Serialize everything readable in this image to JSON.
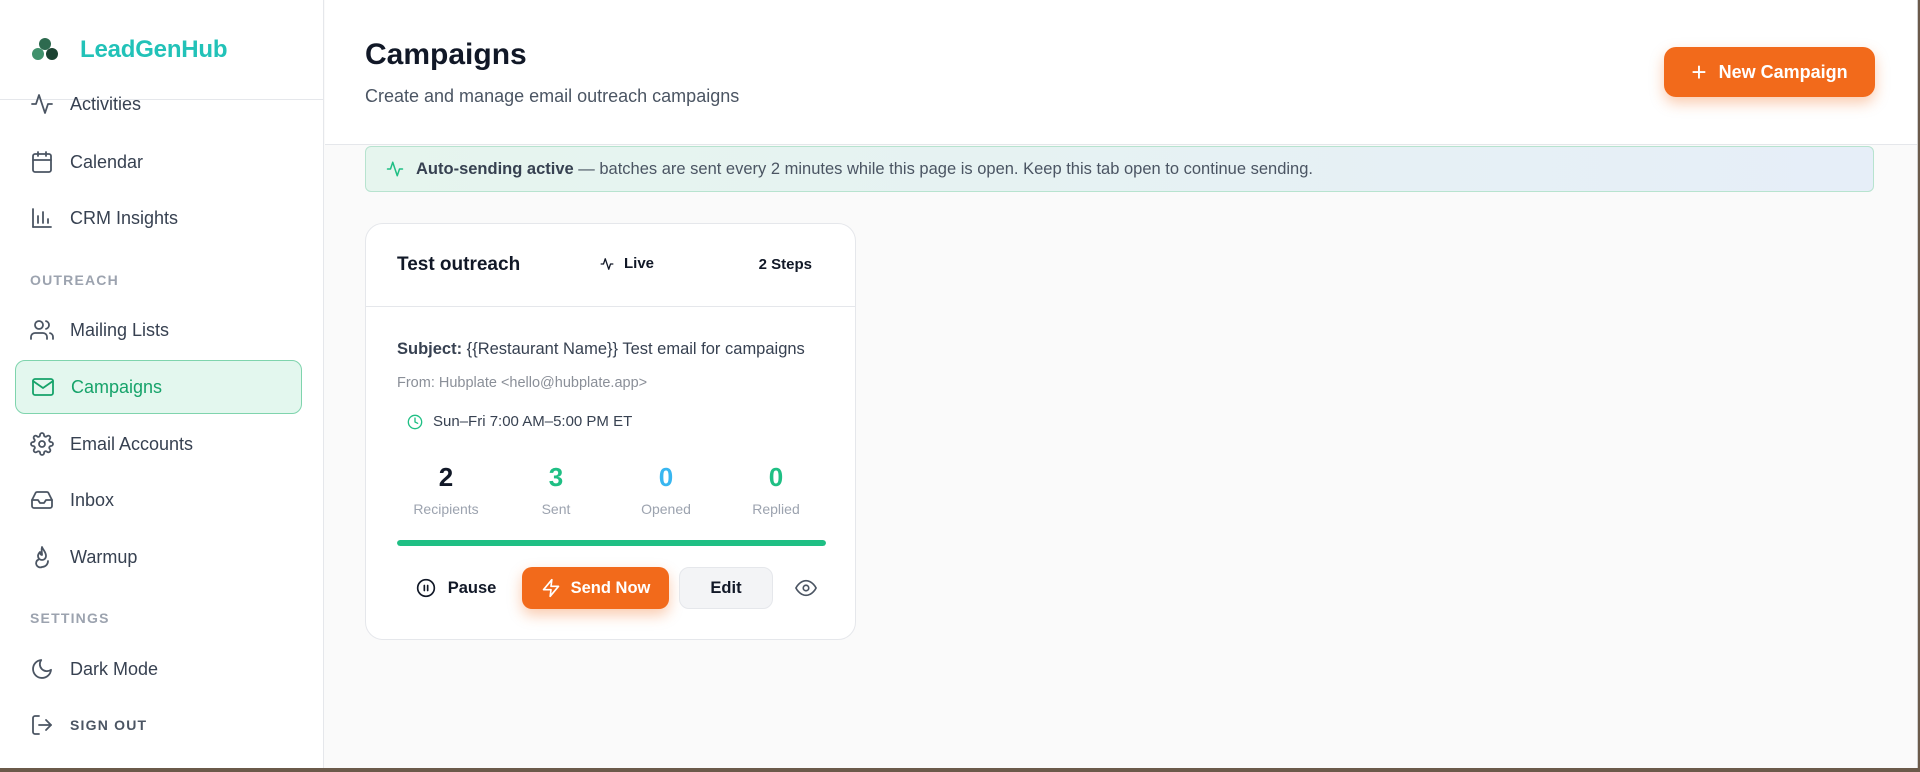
{
  "brand": {
    "name": "LeadGenHub"
  },
  "sidebar": {
    "items": [
      {
        "label": "Activities"
      },
      {
        "label": "Calendar"
      },
      {
        "label": "CRM Insights"
      },
      {
        "label": "Mailing Lists"
      },
      {
        "label": "Campaigns",
        "active": true
      },
      {
        "label": "Email Accounts"
      },
      {
        "label": "Inbox"
      },
      {
        "label": "Warmup"
      },
      {
        "label": "Dark Mode"
      }
    ],
    "sections": {
      "outreach": "OUTREACH",
      "settings": "SETTINGS"
    },
    "signout": "SIGN OUT"
  },
  "header": {
    "title": "Campaigns",
    "subtitle": "Create and manage email outreach campaigns",
    "new_button": "New Campaign"
  },
  "banner": {
    "strong": "Auto-sending active",
    "text": " — batches are sent every 2 minutes while this page is open. Keep this tab open to continue sending."
  },
  "campaign": {
    "name": "Test outreach",
    "status": "Live",
    "steps": "2 Steps",
    "subject_label": "Subject:",
    "subject": " {{Restaurant Name}} Test email for campaigns",
    "from": "From: Hubplate <hello@hubplate.app>",
    "schedule": "Sun–Fri 7:00 AM–5:00 PM ET",
    "stats": {
      "recipients": {
        "value": "2",
        "label": "Recipients"
      },
      "sent": {
        "value": "3",
        "label": "Sent"
      },
      "opened": {
        "value": "0",
        "label": "Opened"
      },
      "replied": {
        "value": "0",
        "label": "Replied"
      }
    },
    "progress_percent": 100,
    "actions": {
      "pause": "Pause",
      "send_now": "Send Now",
      "edit": "Edit"
    }
  },
  "colors": {
    "accent_green": "#1fbf84",
    "brand_teal": "#22c2b8",
    "orange": "#f26a1b",
    "opened_blue": "#38b6f0"
  }
}
